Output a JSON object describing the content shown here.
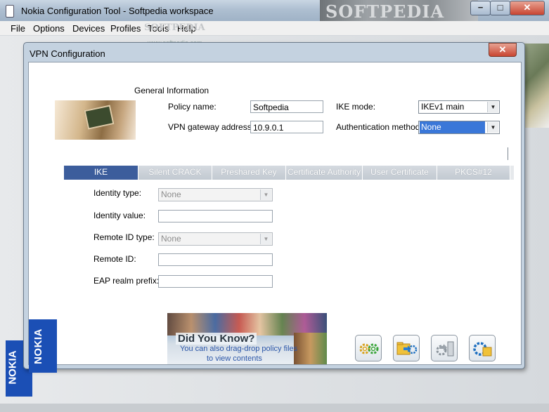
{
  "window": {
    "title": "Nokia Configuration Tool - Softpedia workspace",
    "controls": {
      "minimize": "−",
      "maximize": "□",
      "close": "✕"
    },
    "watermark": "SOFTPEDIA"
  },
  "menu": [
    "File",
    "Options",
    "Devices",
    "Profiles",
    "Tools",
    "Help"
  ],
  "menu_watermark": "SOFTPEDIA",
  "menu_watermark_url": "www.softpedia.com",
  "dialog": {
    "title": "VPN Configuration",
    "close": "✕",
    "section_title": "General Information",
    "policy_name_label": "Policy name:",
    "policy_name_value": "Softpedia",
    "gateway_label": "VPN gateway address:",
    "gateway_value": "10.9.0.1",
    "ike_mode_label": "IKE mode:",
    "ike_mode_value": "IKEv1 main",
    "auth_method_label": "Authentication method:",
    "auth_method_value": "None",
    "tabs": [
      "IKE",
      "Silent CRACK",
      "Preshared Key",
      "Certificate Authority",
      "User Certificate",
      "PKCS#12"
    ],
    "active_tab": "IKE",
    "form": {
      "identity_type_label": "Identity type:",
      "identity_type_value": "None",
      "identity_value_label": "Identity value:",
      "identity_value_value": "",
      "remote_id_type_label": "Remote ID type:",
      "remote_id_type_value": "None",
      "remote_id_label": "Remote ID:",
      "remote_id_value": "",
      "eap_label": "EAP realm prefix:",
      "eap_value": ""
    },
    "brand": "NOKIA",
    "did_you_know": {
      "heading": "Did You Know?",
      "line1": "You can also drag-drop policy files",
      "line2": "to view contents"
    },
    "action_buttons": [
      {
        "icon": "gears-icon"
      },
      {
        "icon": "folder-gear-icon"
      },
      {
        "icon": "export-gear-icon"
      },
      {
        "icon": "save-gear-icon"
      }
    ]
  },
  "colors": {
    "active_tab": "#3c5d9c",
    "nokia_blue": "#1b4fb5",
    "selection": "#3a77d8"
  }
}
